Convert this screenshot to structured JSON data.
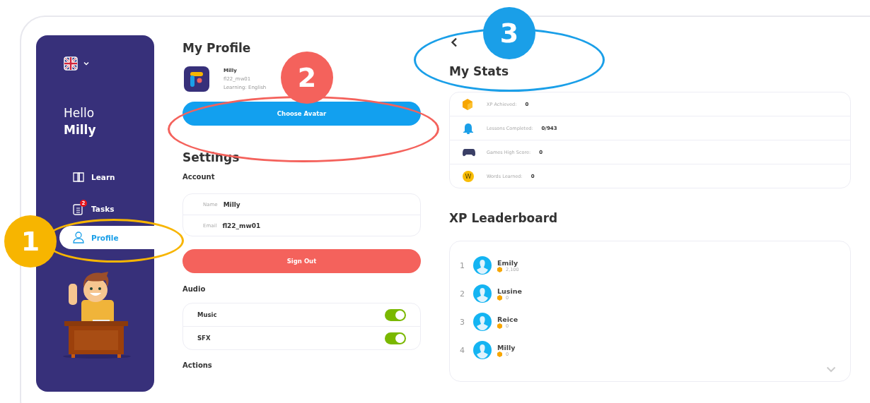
{
  "sidebar": {
    "greeting": "Hello",
    "user_name": "Milly",
    "nav": [
      {
        "label": "Learn",
        "kind": "book",
        "selected": false
      },
      {
        "label": "Tasks",
        "kind": "tasks",
        "selected": false,
        "badge": "2"
      },
      {
        "label": "Profile",
        "kind": "person",
        "selected": true
      }
    ]
  },
  "profile": {
    "title": "My Profile",
    "name": "Milly",
    "username": "fl22_mw01",
    "learning": "Learning: English",
    "button": "Choose Avatar"
  },
  "settings": {
    "title": "Settings",
    "account_heading": "Account",
    "fields": [
      {
        "label": "Name",
        "value": "Milly"
      },
      {
        "label": "Email",
        "value": "fl22_mw01"
      }
    ],
    "sign_out": "Sign Out",
    "audio_heading": "Audio",
    "toggles": [
      {
        "label": "Music",
        "on": true
      },
      {
        "label": "SFX",
        "on": true
      }
    ],
    "actions_heading": "Actions"
  },
  "stats": {
    "title": "My Stats",
    "items": [
      {
        "kind": "xp",
        "label": "XP Achieved:",
        "value": "0"
      },
      {
        "kind": "lessons",
        "label": "Lessons Completed:",
        "value": "0/943"
      },
      {
        "kind": "games",
        "label": "Games High Score:",
        "value": "0"
      },
      {
        "kind": "words",
        "icon_letter": "W",
        "label": "Words Learned:",
        "value": "0"
      }
    ]
  },
  "leaderboard": {
    "title": "XP Leaderboard",
    "entries": [
      {
        "rank": "1",
        "name": "Emily",
        "xp": "2,100"
      },
      {
        "rank": "2",
        "name": "Lusine",
        "xp": "0"
      },
      {
        "rank": "3",
        "name": "Reice",
        "xp": "0"
      },
      {
        "rank": "4",
        "name": "Milly",
        "xp": "0"
      }
    ]
  },
  "annotations": [
    {
      "number": "1",
      "color": "#f7b500"
    },
    {
      "number": "2",
      "color": "#f4625c"
    },
    {
      "number": "3",
      "color": "#1a9fe8"
    }
  ]
}
